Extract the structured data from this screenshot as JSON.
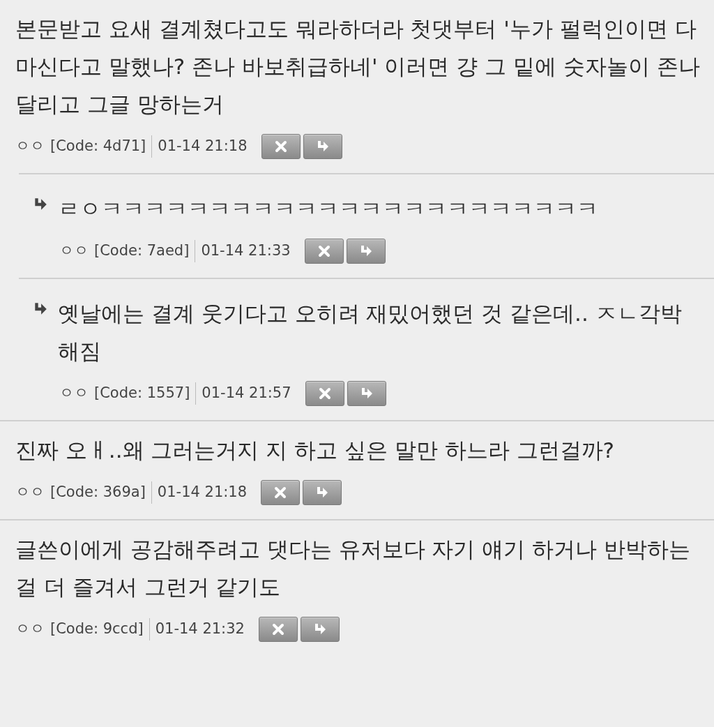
{
  "comments": [
    {
      "kind": "comment",
      "text": "본문받고 요새 결계쳤다고도 뭐라하더라 첫댓부터 '누가 펄럭인이면 다 마신다고 말했나? 존나 바보취급하네' 이러면 걍 그 밑에 숫자놀이 존나 달리고 그글 망하는거",
      "author": "ㅇㅇ",
      "code": "[Code: 4d71]",
      "time": "01-14 21:18"
    },
    {
      "kind": "reply",
      "text": "ㄹㅇㅋㅋㅋㅋㅋㅋㅋㅋㅋㅋㅋㅋㅋㅋㅋㅋㅋㅋㅋㅋㅋㅋㅋ",
      "author": "ㅇㅇ",
      "code": "[Code: 7aed]",
      "time": "01-14 21:33"
    },
    {
      "kind": "reply",
      "text": "옛날에는 결계 웃기다고 오히려 재밌어했던 것 같은데.. ㅈㄴ각박해짐",
      "author": "ㅇㅇ",
      "code": "[Code: 1557]",
      "time": "01-14 21:57"
    },
    {
      "kind": "comment",
      "text": "진짜 오ㅐ..왜 그러는거지 지 하고 싶은 말만 하느라 그런걸까?",
      "author": "ㅇㅇ",
      "code": "[Code: 369a]",
      "time": "01-14 21:18"
    },
    {
      "kind": "comment",
      "text": "글쓴이에게 공감해주려고 댓다는 유저보다 자기 얘기 하거나 반박하는걸 더 즐겨서 그런거 같기도",
      "author": "ㅇㅇ",
      "code": "[Code: 9ccd]",
      "time": "01-14 21:32"
    }
  ]
}
